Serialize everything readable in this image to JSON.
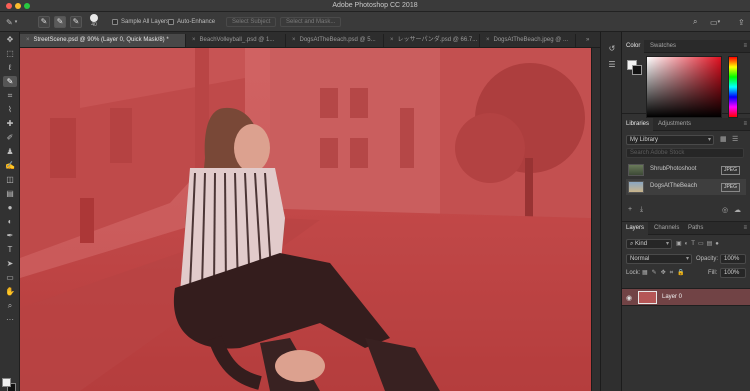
{
  "window": {
    "title": "Adobe Photoshop CC 2018"
  },
  "options_bar": {
    "brush_size": "40",
    "sample_all_layers": "Sample All Layers",
    "auto_enhance": "Auto-Enhance",
    "select_subject": "Select Subject",
    "select_and_mask": "Select and Mask..."
  },
  "document_tabs": [
    {
      "label": "StreetScene.psd @ 90% (Layer 0, Quick Mask/8) *",
      "active": true
    },
    {
      "label": "BeachVolleyball_.psd @ 1..."
    },
    {
      "label": "DogsAtTheBeach.psd @ 5..."
    },
    {
      "label": "レッサーパンダ.psd @ 66.7..."
    },
    {
      "label": "DogsAtTheBeach.jpeg @ ..."
    }
  ],
  "color_panel": {
    "tabs": [
      "Color",
      "Swatches"
    ]
  },
  "libraries_panel": {
    "tabs": [
      "Libraries",
      "Adjustments"
    ],
    "library_select": "My Library",
    "search_placeholder": "Search Adobe Stock",
    "items": [
      {
        "name": "ShrubPhotoshoot",
        "type": "JPEG"
      },
      {
        "name": "DogsAtTheBeach",
        "type": "JPEG"
      }
    ]
  },
  "layers_panel": {
    "tabs": [
      "Layers",
      "Channels",
      "Paths"
    ],
    "filter_kind": "Kind",
    "blend_mode": "Normal",
    "opacity_label": "Opacity:",
    "opacity_value": "100%",
    "lock_label": "Lock:",
    "fill_label": "Fill:",
    "fill_value": "100%",
    "layers": [
      {
        "name": "Layer 0",
        "selected": true
      }
    ]
  },
  "colors": {
    "quick_mask_overlay": "#c24040",
    "selected_layer": "#714345",
    "ui_background": "#323232"
  }
}
